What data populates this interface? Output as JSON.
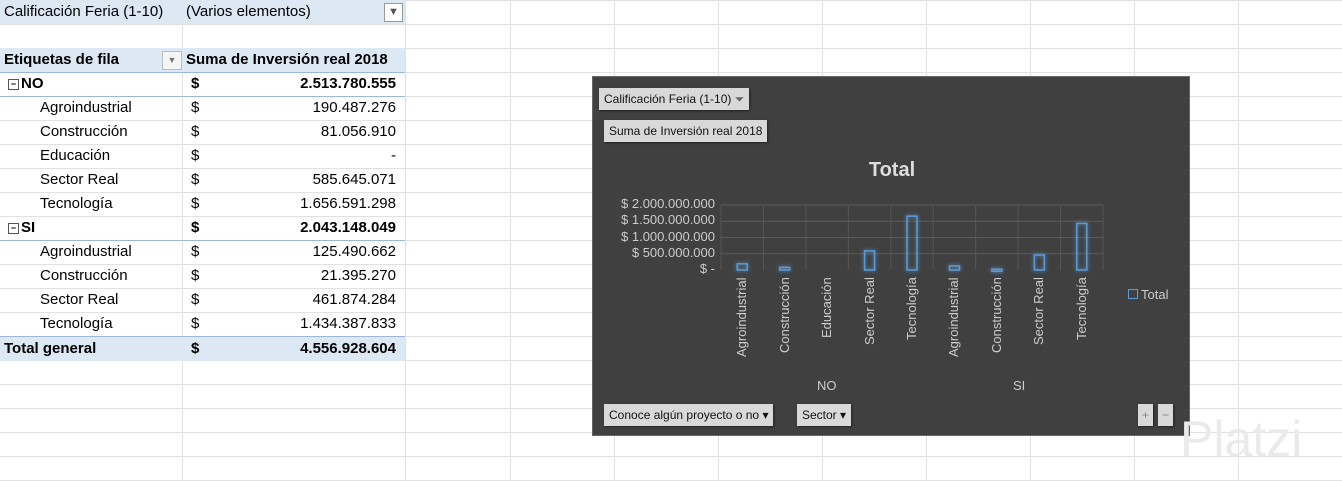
{
  "pivot": {
    "filter_label": "Calificación Feria (1-10)",
    "filter_value": "(Varios elementos)",
    "header_rows": "Etiquetas de fila",
    "header_values": "Suma de Inversión real 2018",
    "currency": "$",
    "rows": [
      {
        "label": "NO",
        "value": "2.513.780.555",
        "level": 0
      },
      {
        "label": "Agroindustrial",
        "value": "190.487.276",
        "level": 1
      },
      {
        "label": "Construcción",
        "value": "81.056.910",
        "level": 1
      },
      {
        "label": "Educación",
        "value": "-",
        "level": 1
      },
      {
        "label": "Sector Real",
        "value": "585.645.071",
        "level": 1
      },
      {
        "label": "Tecnología",
        "value": "1.656.591.298",
        "level": 1
      },
      {
        "label": "SI",
        "value": "2.043.148.049",
        "level": 0
      },
      {
        "label": "Agroindustrial",
        "value": "125.490.662",
        "level": 1
      },
      {
        "label": "Construcción",
        "value": "21.395.270",
        "level": 1
      },
      {
        "label": "Sector Real",
        "value": "461.874.284",
        "level": 1
      },
      {
        "label": "Tecnología",
        "value": "1.434.387.833",
        "level": 1
      }
    ],
    "total_label": "Total general",
    "total_value": "4.556.928.604"
  },
  "chart_buttons": {
    "filter": "Calificación  Feria (1-10)",
    "value_field": "Suma de Inversión  real 2018",
    "axis1": "Conoce algún  proyecto  o no",
    "axis2": "Sector",
    "plus": "+",
    "minus": "−"
  },
  "chart_data": {
    "type": "bar",
    "title": "Total",
    "legend": "Total",
    "legend_position": "right",
    "ylim": [
      0,
      2000000000
    ],
    "yticks": [
      "$ -",
      "$ 500.000.000",
      "$ 1.000.000.000",
      "$ 1.500.000.000",
      "$ 2.000.000.000"
    ],
    "groups": [
      "NO",
      "SI"
    ],
    "categories": [
      "Agroindustrial",
      "Construcción",
      "Educación",
      "Sector Real",
      "Tecnología",
      "Agroindustrial",
      "Construcción",
      "Sector Real",
      "Tecnología"
    ],
    "values": [
      190487276,
      81056910,
      0,
      585645071,
      1656591298,
      125490662,
      21395270,
      461874284,
      1434387833
    ],
    "bar_color": "#5b9bd5"
  },
  "watermark": "Platzi"
}
